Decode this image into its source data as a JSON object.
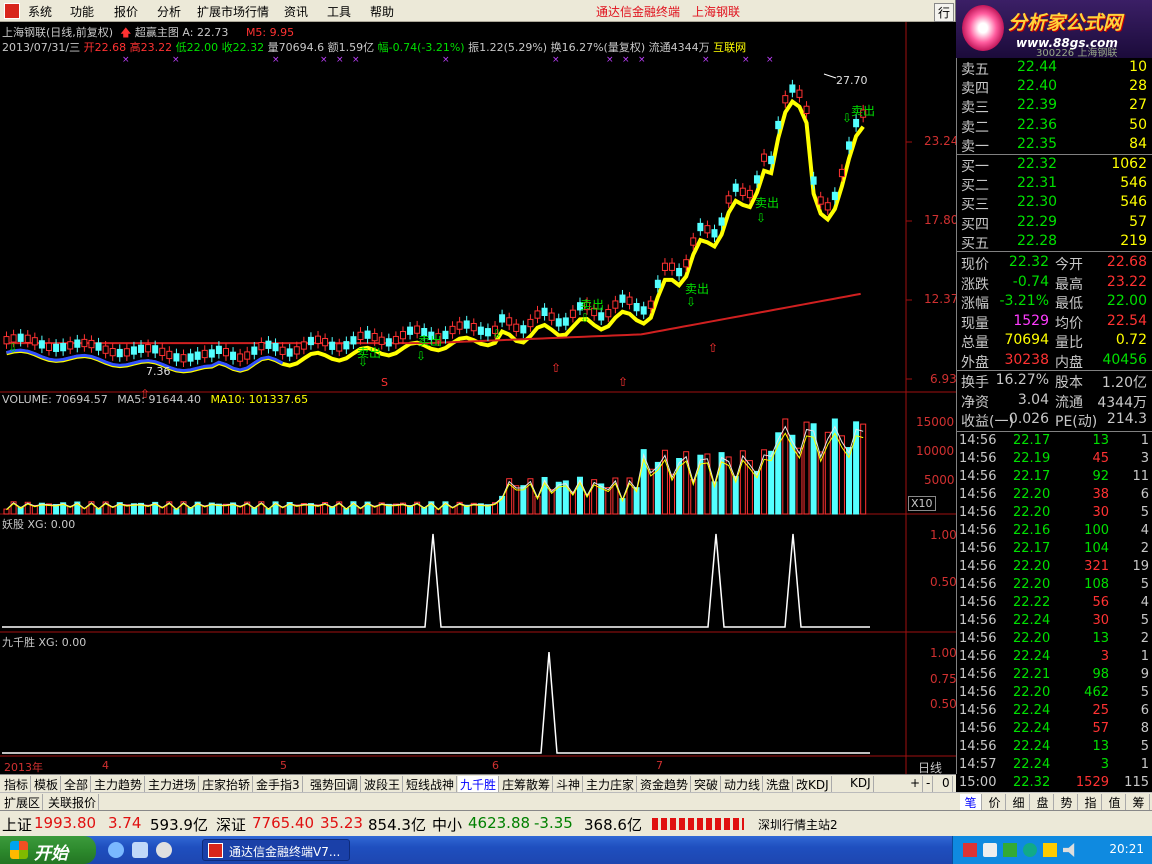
{
  "menu": {
    "items": [
      "系统",
      "功能",
      "报价",
      "分析",
      "扩展市场行情",
      "资讯",
      "工具",
      "帮助"
    ],
    "title_left": "通达信金融终端",
    "title_right": "上海钢联",
    "right_btn": "行"
  },
  "logo": {
    "main": "分析家公式网",
    "sub": "www.88gs.com",
    "stock_code": "300226 上海钢联"
  },
  "chart_header": {
    "line1": {
      "title": "上海钢联(日线,前复权)",
      "indicator": "超赢主图",
      "a": "A: 22.73",
      "m5": "M5: 9.95"
    },
    "line2": {
      "date": "2013/07/31/三",
      "open": "开22.68",
      "high": "高23.22",
      "low": "低22.00",
      "close": "收22.32",
      "vol": "量70694.6",
      "amt": "额1.59亿",
      "chg": "幅-0.74(-3.21%)",
      "amp": "振1.22(5.29%)",
      "turn": "换16.27%(量复权)",
      "float": "流通4344万",
      "concept": "互联网"
    }
  },
  "colors": {
    "up": "#ff3232",
    "down": "#54ffff",
    "yellow": "#ffff00",
    "green": "#00e000",
    "blue": "#2f4fff",
    "ma_red": "#d02020",
    "axis_text": "#d03030"
  },
  "price_axis": {
    "labels": [
      "23.24",
      "17.80",
      "12.37",
      "6.93"
    ]
  },
  "price_annotations": {
    "high": "27.70",
    "low": "7.36",
    "sell": "卖出",
    "buy": "S"
  },
  "volume_panel": {
    "header": {
      "volume": "VOLUME: 70694.57",
      "ma5": "MA5: 91644.40",
      "ma10": "MA10: 101337.65"
    },
    "axis": [
      "15000",
      "10000",
      "5000"
    ],
    "unit": "X10"
  },
  "yaogu_panel": {
    "header": "妖股 XG: 0.00",
    "axis": [
      "1.00",
      "0.50"
    ]
  },
  "jiuqiansheng_panel": {
    "header": "九千胜 XG: 0.00",
    "axis": [
      "1.00",
      "0.75",
      "0.50"
    ]
  },
  "x_axis": {
    "labels": [
      "2013年",
      "4",
      "5",
      "6",
      "7"
    ],
    "period": "日线"
  },
  "chart_data": [
    {
      "type": "candlestick",
      "title": "上海钢联(日线,前复权)",
      "ylim": [
        6.93,
        27.7
      ],
      "y_ticks": [
        23.24,
        17.8,
        12.37,
        6.93
      ],
      "high_label": 27.7,
      "low_label": 7.36,
      "last_close": 22.32
    },
    {
      "type": "bar",
      "title": "VOLUME",
      "y_ticks": [
        15000,
        10000,
        5000
      ],
      "unit": "X10",
      "last": 70694.57,
      "ma5": 91644.4,
      "ma10": 101337.65
    },
    {
      "type": "line",
      "title": "妖股 XG",
      "ylim": [
        0,
        1
      ],
      "y_ticks": [
        1.0,
        0.5
      ],
      "spikes_at_month": [
        "6",
        "7",
        "7"
      ],
      "last": 0.0
    },
    {
      "type": "line",
      "title": "九千胜 XG",
      "ylim": [
        0,
        1
      ],
      "y_ticks": [
        1.0,
        0.75,
        0.5
      ],
      "spikes_at_month": [
        "6"
      ],
      "last": 0.0
    }
  ],
  "orderbook": {
    "sells": [
      {
        "label": "卖五",
        "price": "22.44",
        "vol": "10"
      },
      {
        "label": "卖四",
        "price": "22.40",
        "vol": "28"
      },
      {
        "label": "卖三",
        "price": "22.39",
        "vol": "27"
      },
      {
        "label": "卖二",
        "price": "22.36",
        "vol": "50"
      },
      {
        "label": "卖一",
        "price": "22.35",
        "vol": "84"
      }
    ],
    "buys": [
      {
        "label": "买一",
        "price": "22.32",
        "vol": "1062"
      },
      {
        "label": "买二",
        "price": "22.31",
        "vol": "546"
      },
      {
        "label": "买三",
        "price": "22.30",
        "vol": "546"
      },
      {
        "label": "买四",
        "price": "22.29",
        "vol": "57"
      },
      {
        "label": "买五",
        "price": "22.28",
        "vol": "219"
      }
    ]
  },
  "stats": [
    {
      "l1": "现价",
      "v1": "22.32",
      "l2": "今开",
      "v2": "22.68"
    },
    {
      "l1": "涨跌",
      "v1": "-0.74",
      "l2": "最高",
      "v2": "23.22"
    },
    {
      "l1": "涨幅",
      "v1": "-3.21%",
      "l2": "最低",
      "v2": "22.00"
    },
    {
      "l1": "现量",
      "v1": "1529",
      "l2": "均价",
      "v2": "22.54"
    },
    {
      "l1": "总量",
      "v1": "70694",
      "l2": "量比",
      "v2": "0.72"
    },
    {
      "l1": "外盘",
      "v1": "30238",
      "l2": "内盘",
      "v2": "40456"
    },
    {
      "l1": "换手",
      "v1": "16.27%",
      "l2": "股本",
      "v2": "1.20亿"
    },
    {
      "l1": "净资",
      "v1": "3.04",
      "l2": "流通",
      "v2": "4344万"
    },
    {
      "l1": "收益(一)",
      "v1": "0.026",
      "l2": "PE(动)",
      "v2": "214.3"
    }
  ],
  "ticks": [
    {
      "time": "14:56",
      "price": "22.17",
      "vol": "13",
      "n": "1",
      "c": "g"
    },
    {
      "time": "14:56",
      "price": "22.19",
      "vol": "45",
      "n": "3",
      "c": "r"
    },
    {
      "time": "14:56",
      "price": "22.17",
      "vol": "92",
      "n": "11",
      "c": "g"
    },
    {
      "time": "14:56",
      "price": "22.20",
      "vol": "38",
      "n": "6",
      "c": "r"
    },
    {
      "time": "14:56",
      "price": "22.20",
      "vol": "30",
      "n": "5",
      "c": "r"
    },
    {
      "time": "14:56",
      "price": "22.16",
      "vol": "100",
      "n": "4",
      "c": "g"
    },
    {
      "time": "14:56",
      "price": "22.17",
      "vol": "104",
      "n": "2",
      "c": "g"
    },
    {
      "time": "14:56",
      "price": "22.20",
      "vol": "321",
      "n": "19",
      "c": "r"
    },
    {
      "time": "14:56",
      "price": "22.20",
      "vol": "108",
      "n": "5",
      "c": "g"
    },
    {
      "time": "14:56",
      "price": "22.22",
      "vol": "56",
      "n": "4",
      "c": "r"
    },
    {
      "time": "14:56",
      "price": "22.24",
      "vol": "30",
      "n": "5",
      "c": "r"
    },
    {
      "time": "14:56",
      "price": "22.20",
      "vol": "13",
      "n": "2",
      "c": "g"
    },
    {
      "time": "14:56",
      "price": "22.24",
      "vol": "3",
      "n": "1",
      "c": "r"
    },
    {
      "time": "14:56",
      "price": "22.21",
      "vol": "98",
      "n": "9",
      "c": "g"
    },
    {
      "time": "14:56",
      "price": "22.20",
      "vol": "462",
      "n": "5",
      "c": "g"
    },
    {
      "time": "14:56",
      "price": "22.24",
      "vol": "25",
      "n": "6",
      "c": "r"
    },
    {
      "time": "14:56",
      "price": "22.24",
      "vol": "57",
      "n": "8",
      "c": "r"
    },
    {
      "time": "14:56",
      "price": "22.24",
      "vol": "13",
      "n": "5",
      "c": "g"
    },
    {
      "time": "14:57",
      "price": "22.24",
      "vol": "3",
      "n": "1",
      "c": "g"
    },
    {
      "time": "15:00",
      "price": "22.32",
      "vol": "1529",
      "n": "115",
      "c": "r"
    }
  ],
  "tabs": [
    "指标",
    "模板",
    "全部",
    "主力趋势",
    "主力进场",
    "庄家抬轿",
    "金手指3",
    "强势回调",
    "波段王",
    "短线战神",
    "九千胜",
    "庄筹散筹",
    "斗神",
    "主力庄家",
    "资金趋势",
    "突破",
    "动力线",
    "洗盘",
    "改KDJ",
    "KDJ"
  ],
  "tabs_active": "九千胜",
  "tabs_controls": [
    "+",
    "-",
    "0"
  ],
  "tabs2": [
    "扩展区",
    "关联报价"
  ],
  "right_tabs": [
    "笔",
    "价",
    "细",
    "盘",
    "势",
    "指",
    "值",
    "筹"
  ],
  "status": {
    "sh_label": "上证",
    "sh_val": "1993.80",
    "sh_chg": "3.74",
    "sh_amt": "593.9亿",
    "sz_label": "深证",
    "sz_val": "7765.40",
    "sz_chg": "35.23",
    "sz_amt": "854.3亿",
    "zx_label": "中小",
    "zx_val": "4623.88",
    "zx_chg": "-3.35",
    "zx_amt": "368.6亿",
    "server": "深圳行情主站2"
  },
  "taskbar": {
    "start": "开始",
    "task": "通达信金融终端V7...",
    "clock": "20:21"
  }
}
